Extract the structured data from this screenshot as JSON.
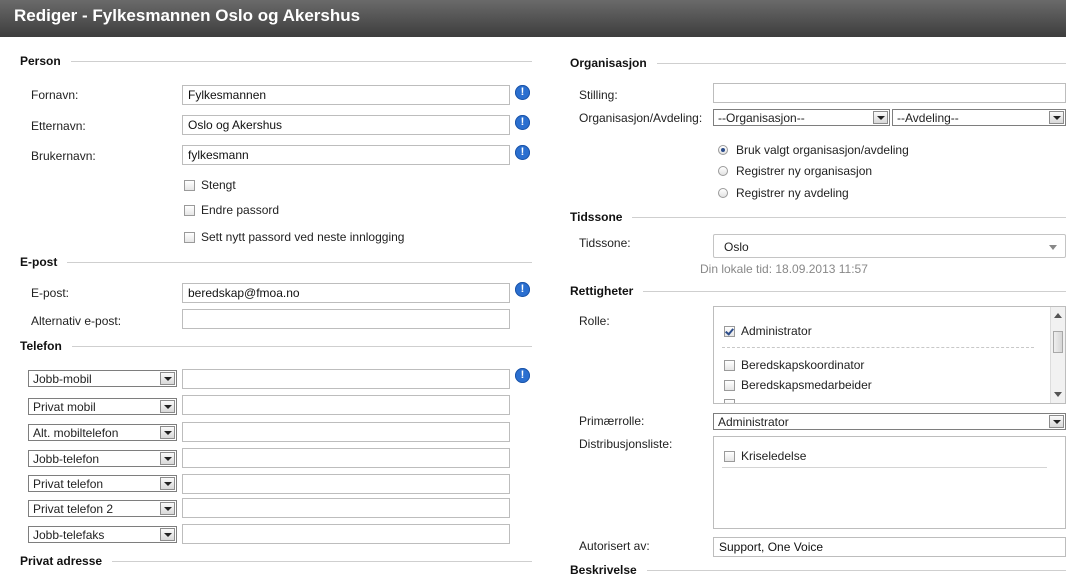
{
  "title": "Rediger - Fylkesmannen Oslo og Akershus",
  "person": {
    "heading": "Person",
    "fornavn_label": "Fornavn:",
    "fornavn": "Fylkesmannen",
    "etternavn_label": "Etternavn:",
    "etternavn": "Oslo og Akershus",
    "brukernavn_label": "Brukernavn:",
    "brukernavn": "fylkesmann",
    "info_glyph": "!",
    "checkboxes": [
      {
        "label": "Stengt",
        "checked": false
      },
      {
        "label": "Endre passord",
        "checked": false
      },
      {
        "label": "Sett nytt passord ved neste innlogging",
        "checked": false
      }
    ]
  },
  "epost": {
    "heading": "E-post",
    "epost_label": "E-post:",
    "epost": "beredskap@fmoa.no",
    "alt_label": "Alternativ e-post:",
    "alt": ""
  },
  "telefon": {
    "heading": "Telefon",
    "rows": [
      {
        "type": "Jobb-mobil",
        "value": ""
      },
      {
        "type": "Privat mobil",
        "value": ""
      },
      {
        "type": "Alt. mobiltelefon",
        "value": ""
      },
      {
        "type": "Jobb-telefon",
        "value": ""
      },
      {
        "type": "Privat telefon",
        "value": ""
      },
      {
        "type": "Privat telefon 2",
        "value": ""
      },
      {
        "type": "Jobb-telefaks",
        "value": ""
      }
    ]
  },
  "privat_adresse": {
    "heading": "Privat adresse"
  },
  "organisasjon": {
    "heading": "Organisasjon",
    "stilling_label": "Stilling:",
    "stilling": "",
    "orgavd_label": "Organisasjon/Avdeling:",
    "org_select": "--Organisasjon--",
    "avd_select": "--Avdeling--",
    "radios": [
      {
        "label": "Bruk valgt organisasjon/avdeling",
        "checked": true
      },
      {
        "label": "Registrer ny organisasjon",
        "checked": false
      },
      {
        "label": "Registrer ny avdeling",
        "checked": false
      }
    ]
  },
  "tidssone": {
    "heading": "Tidssone",
    "label": "Tidssone:",
    "value": "Oslo",
    "local_time": "Din lokale tid: 18.09.2013 11:57"
  },
  "rettigheter": {
    "heading": "Rettigheter",
    "rolle_label": "Rolle:",
    "roles": [
      {
        "label": "Administrator",
        "checked": true
      },
      {
        "label": "Beredskapskoordinator",
        "checked": false
      },
      {
        "label": "Beredskapsmedarbeider",
        "checked": false
      }
    ],
    "primaerrolle_label": "Primærrolle:",
    "primaerrolle": "Administrator",
    "distribusjon_label": "Distribusjonsliste:",
    "distribusjon": [
      {
        "label": "Kriseledelse",
        "checked": false
      }
    ],
    "autorisert_label": "Autorisert av:",
    "autorisert": "Support, One Voice"
  },
  "beskrivelse": {
    "heading": "Beskrivelse"
  }
}
